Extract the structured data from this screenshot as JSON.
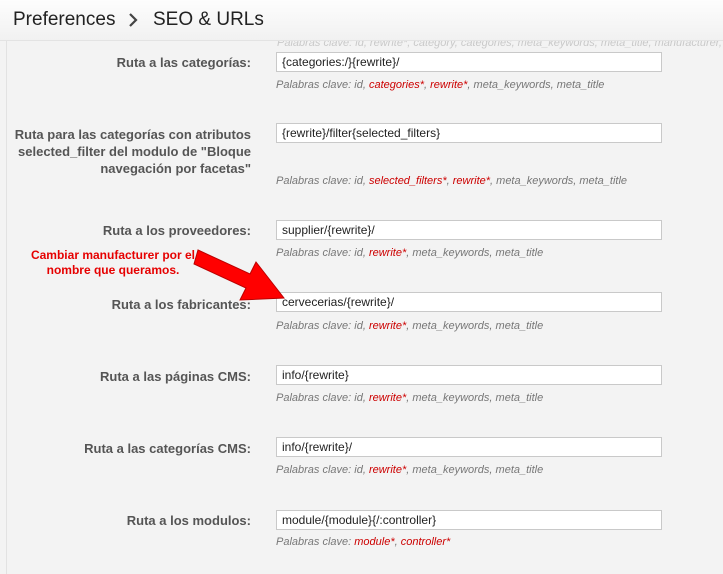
{
  "breadcrumb": {
    "parent": "Preferences",
    "current": "SEO & URLs"
  },
  "ghost_text": "Palabras clave: id, rewrite*, category, categories, meta_keywords, meta_title, manufacturer, supplier*, price, tags",
  "rows": [
    {
      "label": "Ruta a las categorías:",
      "value": "{categories:/}{rewrite}/",
      "hint_prefix": "Palabras clave: ",
      "keywords": [
        {
          "text": "id",
          "required": false
        },
        {
          "text": "categories*",
          "required": true
        },
        {
          "text": "rewrite*",
          "required": true
        },
        {
          "text": "meta_keywords",
          "required": false
        },
        {
          "text": "meta_title",
          "required": false
        }
      ]
    },
    {
      "label": "Ruta para las categorías con atributos selected_filter del modulo de \"Bloque navegación por facetas\"",
      "value": "{rewrite}/filter{selected_filters}",
      "hint_prefix": "Palabras clave: ",
      "keywords": [
        {
          "text": "id",
          "required": false
        },
        {
          "text": "selected_filters*",
          "required": true
        },
        {
          "text": "rewrite*",
          "required": true
        },
        {
          "text": "meta_keywords",
          "required": false
        },
        {
          "text": "meta_title",
          "required": false
        }
      ]
    },
    {
      "label": "Ruta a los proveedores:",
      "value": "supplier/{rewrite}/",
      "hint_prefix": "Palabras clave: ",
      "keywords": [
        {
          "text": "id",
          "required": false
        },
        {
          "text": "rewrite*",
          "required": true
        },
        {
          "text": "meta_keywords",
          "required": false
        },
        {
          "text": "meta_title",
          "required": false
        }
      ]
    },
    {
      "label": "Ruta a los fabricantes:",
      "value": "cervecerias/{rewrite}/",
      "hint_prefix": "Palabras clave: ",
      "keywords": [
        {
          "text": "id",
          "required": false
        },
        {
          "text": "rewrite*",
          "required": true
        },
        {
          "text": "meta_keywords",
          "required": false
        },
        {
          "text": "meta_title",
          "required": false
        }
      ]
    },
    {
      "label": "Ruta a las páginas CMS:",
      "value": "info/{rewrite}",
      "hint_prefix": "Palabras clave: ",
      "keywords": [
        {
          "text": "id",
          "required": false
        },
        {
          "text": "rewrite*",
          "required": true
        },
        {
          "text": "meta_keywords",
          "required": false
        },
        {
          "text": "meta_title",
          "required": false
        }
      ]
    },
    {
      "label": "Ruta a las categorías CMS:",
      "value": "info/{rewrite}/",
      "hint_prefix": "Palabras clave: ",
      "keywords": [
        {
          "text": "id",
          "required": false
        },
        {
          "text": "rewrite*",
          "required": true
        },
        {
          "text": "meta_keywords",
          "required": false
        },
        {
          "text": "meta_title",
          "required": false
        }
      ]
    },
    {
      "label": "Ruta a los modulos:",
      "value": "module/{module}{/:controller}",
      "hint_prefix": "Palabras clave: ",
      "keywords": [
        {
          "text": "module*",
          "required": true
        },
        {
          "text": "controller*",
          "required": true
        }
      ]
    }
  ],
  "annotation": {
    "text": "Cambiar manufacturer por el nombre que queramos.",
    "color": "#e60000"
  },
  "colors": {
    "required_keyword": "#cc0000",
    "hint": "#777777",
    "label": "#555555"
  }
}
